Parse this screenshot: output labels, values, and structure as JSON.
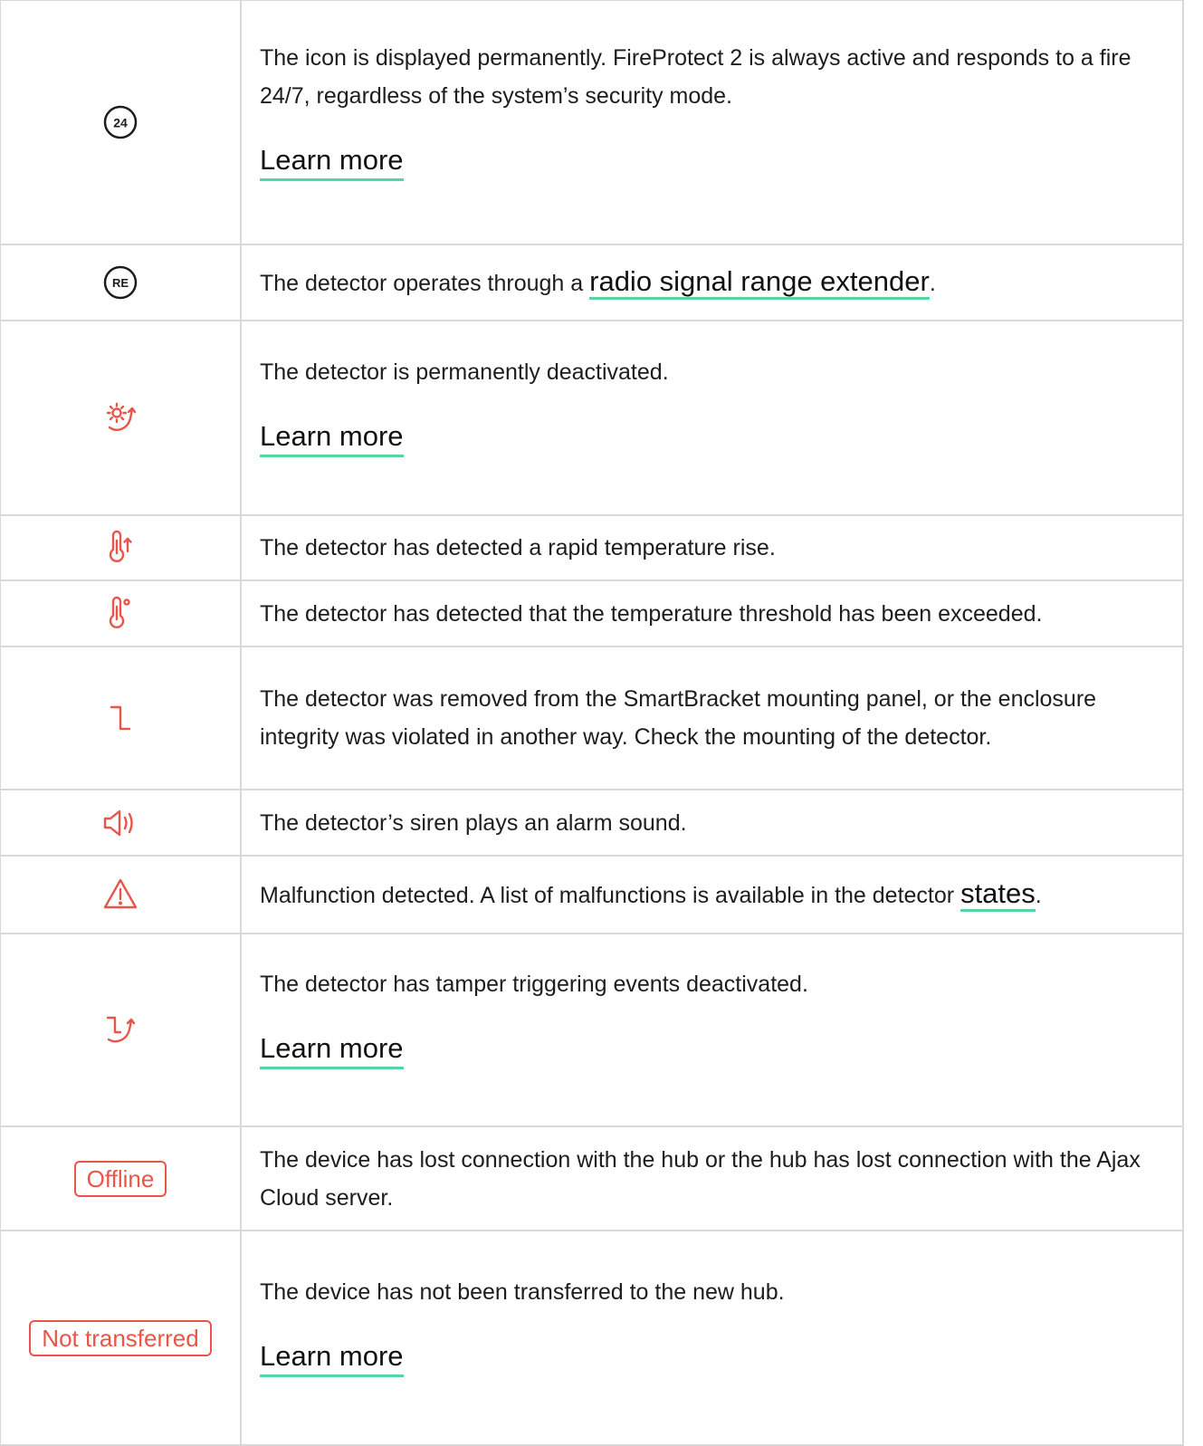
{
  "colors": {
    "accent_red": "#e8564a",
    "link_underline": "#55d6a0",
    "border": "#d9d9d9",
    "text": "#1d1d1f"
  },
  "rows": [
    {
      "icon": "24-7-icon",
      "icon_text": "24",
      "text": "The icon is displayed permanently. FireProtect 2 is always active and responds to a fire 24/7, regardless of the system’s security mode.",
      "link": "Learn more"
    },
    {
      "icon": "range-extender-icon",
      "icon_text": "RE",
      "text_before": "The detector operates through a ",
      "link": "radio signal range extender",
      "text_after": "."
    },
    {
      "icon": "permanently-deactivated-icon",
      "text": "The detector is permanently deactivated.",
      "link": "Learn more"
    },
    {
      "icon": "temperature-rise-icon",
      "text": "The detector has detected a rapid temperature rise."
    },
    {
      "icon": "temperature-threshold-icon",
      "text": "The detector has detected that the temperature threshold has been exceeded."
    },
    {
      "icon": "tamper-icon",
      "text": "The detector was removed from the SmartBracket mounting panel, or the enclosure integrity was violated in another way. Check the mounting of the detector."
    },
    {
      "icon": "siren-icon",
      "text": "The detector’s siren plays an alarm sound."
    },
    {
      "icon": "malfunction-warning-icon",
      "text_before": "Malfunction detected. A list of malfunctions is available in the detector ",
      "link": "states",
      "text_after": "."
    },
    {
      "icon": "tamper-deactivated-icon",
      "text": "The detector has tamper triggering events deactivated.",
      "link": "Learn more"
    },
    {
      "badge": "Offline",
      "text": "The device has lost connection with the hub or the hub has lost connection with the Ajax Cloud server."
    },
    {
      "badge": "Not transferred",
      "text": "The device has not been transferred to the new hub.",
      "link": "Learn more"
    }
  ]
}
